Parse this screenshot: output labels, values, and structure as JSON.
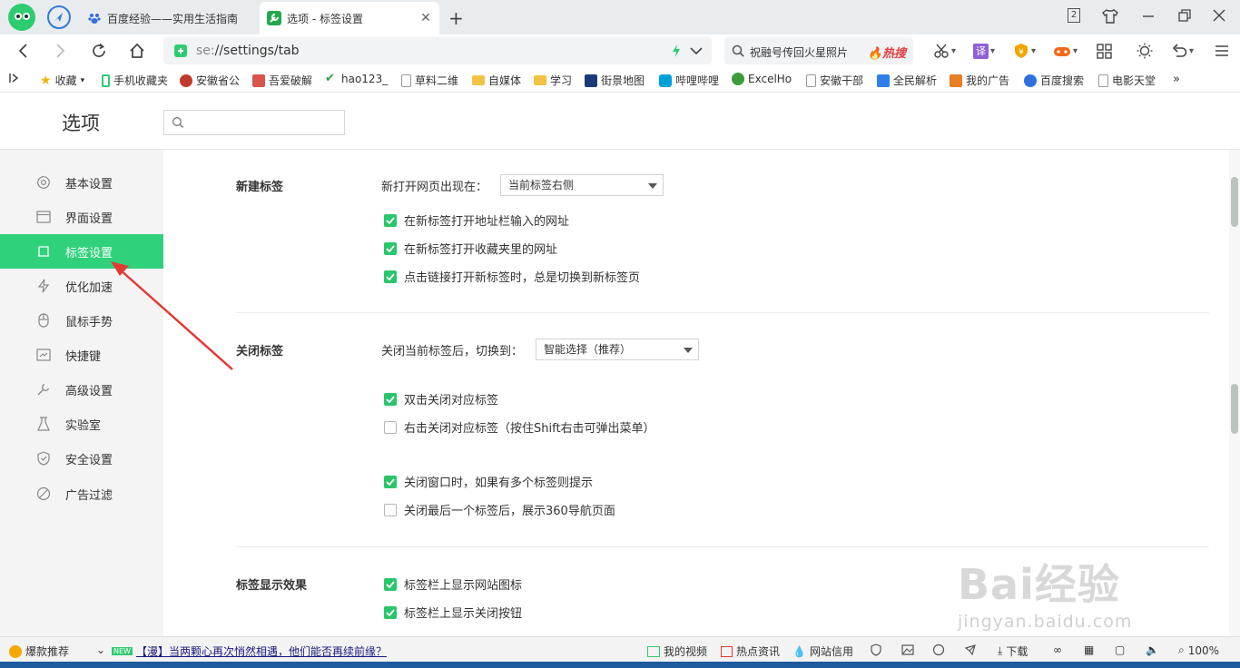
{
  "browser": {
    "tabs": [
      {
        "title": "百度经验——实用生活指南",
        "favicon": "baidu-paw-icon"
      },
      {
        "title": "选项 - 标签设置",
        "favicon": "settings-wrench-icon"
      }
    ],
    "tab_count_badge": "2",
    "url": {
      "scheme": "se:",
      "path": "//settings/tab"
    },
    "search": {
      "query": "祝融号传回火星照片",
      "hot_label": "热搜"
    },
    "translate_label": "译"
  },
  "bookmarks": [
    {
      "label": "收藏",
      "icon": "star-icon",
      "color": "#f0b400"
    },
    {
      "label": "手机收藏夹",
      "icon": "phone-icon",
      "color": "#2ecc71"
    },
    {
      "label": "安徽省公",
      "icon": "emblem-icon",
      "color": "#c0392b"
    },
    {
      "label": "吾爱破解",
      "icon": "square-logo-icon",
      "color": "#d9534f"
    },
    {
      "label": "hao123_",
      "icon": "hao-icon",
      "color": "#2a9d40"
    },
    {
      "label": "草料二维",
      "icon": "doc-icon",
      "color": "#999999"
    },
    {
      "label": "自媒体",
      "icon": "folder-icon",
      "color": "#f4c242"
    },
    {
      "label": "学习",
      "icon": "folder-icon",
      "color": "#f4c242"
    },
    {
      "label": "街景地图",
      "icon": "street-icon",
      "color": "#1b3a7a"
    },
    {
      "label": "哔哩哔哩",
      "icon": "bilibili-icon",
      "color": "#00a1d6"
    },
    {
      "label": "ExcelHo",
      "icon": "globe-icon",
      "color": "#3a9d3a"
    },
    {
      "label": "安徽干部",
      "icon": "doc-icon",
      "color": "#999999"
    },
    {
      "label": "全民解析",
      "icon": "play-icon",
      "color": "#2f80ed"
    },
    {
      "label": "我的广告",
      "icon": "ad-icon",
      "color": "#e67e22"
    },
    {
      "label": "百度搜索",
      "icon": "baidu-paw-icon",
      "color": "#2f6fe0"
    },
    {
      "label": "电影天堂",
      "icon": "doc-icon",
      "color": "#999999"
    }
  ],
  "settings": {
    "title": "选项",
    "search_placeholder": "",
    "sidebar": [
      {
        "label": "基本设置",
        "icon": "gear-icon"
      },
      {
        "label": "界面设置",
        "icon": "window-icon"
      },
      {
        "label": "标签设置",
        "icon": "tab-icon"
      },
      {
        "label": "优化加速",
        "icon": "lightning-icon"
      },
      {
        "label": "鼠标手势",
        "icon": "mouse-icon"
      },
      {
        "label": "快捷键",
        "icon": "keyboard-icon"
      },
      {
        "label": "高级设置",
        "icon": "wrench-icon"
      },
      {
        "label": "实验室",
        "icon": "flask-icon"
      },
      {
        "label": "安全设置",
        "icon": "shield-icon"
      },
      {
        "label": "广告过滤",
        "icon": "block-icon"
      }
    ],
    "active_index": 2,
    "sections": {
      "new_tab": {
        "title": "新建标签",
        "open_label": "新打开网页出现在：",
        "open_value": "当前标签右侧",
        "options": [
          {
            "label": "在新标签打开地址栏输入的网址",
            "checked": true
          },
          {
            "label": "在新标签打开收藏夹里的网址",
            "checked": true
          },
          {
            "label": "点击链接打开新标签时，总是切换到新标签页",
            "checked": true
          }
        ]
      },
      "close_tab": {
        "title": "关闭标签",
        "switch_label": "关闭当前标签后，切换到：",
        "switch_value": "智能选择（推荐）",
        "options": [
          {
            "label": "双击关闭对应标签",
            "checked": true
          },
          {
            "label": "右击关闭对应标签（按住Shift右击可弹出菜单）",
            "checked": false
          },
          {
            "label": "关闭窗口时，如果有多个标签则提示",
            "checked": true
          },
          {
            "label": "关闭最后一个标签后，展示360导航页面",
            "checked": false
          }
        ]
      },
      "tab_display": {
        "title": "标签显示效果",
        "options": [
          {
            "label": "标签栏上显示网站图标",
            "checked": true
          },
          {
            "label": "标签栏上显示关闭按钮",
            "checked": true
          }
        ]
      }
    }
  },
  "watermark": {
    "brand": "Bai经验",
    "domain": "jingyan.baidu.com"
  },
  "statusbar": {
    "promo_label": "爆款推荐",
    "new_badge": "NEW",
    "news": "【漫】当两颗心再次悄然相遇，他们能否再续前缘？",
    "items": [
      "我的视频",
      "热点资讯",
      "网站信用",
      "下载"
    ],
    "zoom": "100%"
  },
  "colors": {
    "accent": "#2fd27a",
    "checkbox": "#2ac66b",
    "annotation_arrow": "#e53935"
  }
}
